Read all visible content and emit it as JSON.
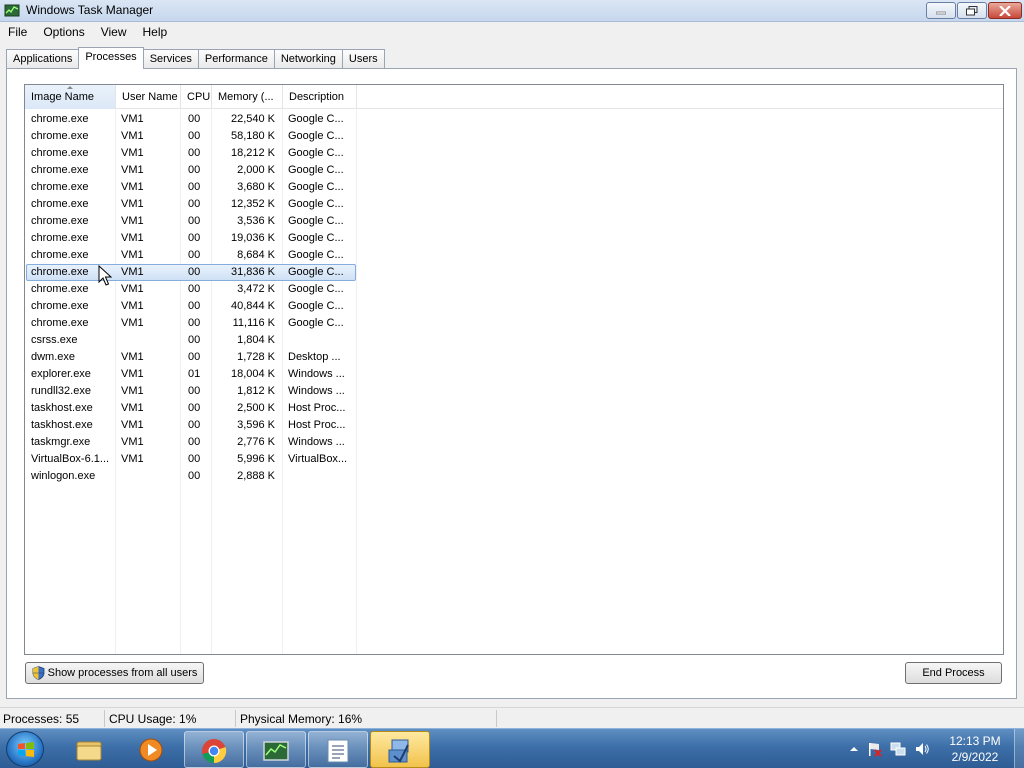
{
  "window": {
    "title": "Windows Task Manager",
    "buttons": [
      "minimize",
      "maximize",
      "close"
    ]
  },
  "menu": [
    "File",
    "Options",
    "View",
    "Help"
  ],
  "tabs": [
    {
      "label": "Applications",
      "active": false
    },
    {
      "label": "Processes",
      "active": true
    },
    {
      "label": "Services",
      "active": false
    },
    {
      "label": "Performance",
      "active": false
    },
    {
      "label": "Networking",
      "active": false
    },
    {
      "label": "Users",
      "active": false
    }
  ],
  "columns": {
    "image_name": "Image Name",
    "user_name": "User Name",
    "cpu": "CPU",
    "memory": "Memory (...",
    "description": "Description"
  },
  "processes": [
    {
      "name": "chrome.exe",
      "user": "VM1",
      "cpu": "00",
      "mem": "22,540 K",
      "desc": "Google C..."
    },
    {
      "name": "chrome.exe",
      "user": "VM1",
      "cpu": "00",
      "mem": "58,180 K",
      "desc": "Google C..."
    },
    {
      "name": "chrome.exe",
      "user": "VM1",
      "cpu": "00",
      "mem": "18,212 K",
      "desc": "Google C..."
    },
    {
      "name": "chrome.exe",
      "user": "VM1",
      "cpu": "00",
      "mem": "2,000 K",
      "desc": "Google C..."
    },
    {
      "name": "chrome.exe",
      "user": "VM1",
      "cpu": "00",
      "mem": "3,680 K",
      "desc": "Google C..."
    },
    {
      "name": "chrome.exe",
      "user": "VM1",
      "cpu": "00",
      "mem": "12,352 K",
      "desc": "Google C..."
    },
    {
      "name": "chrome.exe",
      "user": "VM1",
      "cpu": "00",
      "mem": "3,536 K",
      "desc": "Google C..."
    },
    {
      "name": "chrome.exe",
      "user": "VM1",
      "cpu": "00",
      "mem": "19,036 K",
      "desc": "Google C..."
    },
    {
      "name": "chrome.exe",
      "user": "VM1",
      "cpu": "00",
      "mem": "8,684 K",
      "desc": "Google C..."
    },
    {
      "name": "chrome.exe",
      "user": "VM1",
      "cpu": "00",
      "mem": "31,836 K",
      "desc": "Google C...",
      "selected": true
    },
    {
      "name": "chrome.exe",
      "user": "VM1",
      "cpu": "00",
      "mem": "3,472 K",
      "desc": "Google C..."
    },
    {
      "name": "chrome.exe",
      "user": "VM1",
      "cpu": "00",
      "mem": "40,844 K",
      "desc": "Google C..."
    },
    {
      "name": "chrome.exe",
      "user": "VM1",
      "cpu": "00",
      "mem": "11,116 K",
      "desc": "Google C..."
    },
    {
      "name": "csrss.exe",
      "user": "",
      "cpu": "00",
      "mem": "1,804 K",
      "desc": ""
    },
    {
      "name": "dwm.exe",
      "user": "VM1",
      "cpu": "00",
      "mem": "1,728 K",
      "desc": "Desktop ..."
    },
    {
      "name": "explorer.exe",
      "user": "VM1",
      "cpu": "01",
      "mem": "18,004 K",
      "desc": "Windows ..."
    },
    {
      "name": "rundll32.exe",
      "user": "VM1",
      "cpu": "00",
      "mem": "1,812 K",
      "desc": "Windows ..."
    },
    {
      "name": "taskhost.exe",
      "user": "VM1",
      "cpu": "00",
      "mem": "2,500 K",
      "desc": "Host Proc..."
    },
    {
      "name": "taskhost.exe",
      "user": "VM1",
      "cpu": "00",
      "mem": "3,596 K",
      "desc": "Host Proc..."
    },
    {
      "name": "taskmgr.exe",
      "user": "VM1",
      "cpu": "00",
      "mem": "2,776 K",
      "desc": "Windows ..."
    },
    {
      "name": "VirtualBox-6.1...",
      "user": "VM1",
      "cpu": "00",
      "mem": "5,996 K",
      "desc": "VirtualBox..."
    },
    {
      "name": "winlogon.exe",
      "user": "",
      "cpu": "00",
      "mem": "2,888 K",
      "desc": ""
    }
  ],
  "buttons": {
    "show_all": "Show processes from all users",
    "end_process": "End Process"
  },
  "status": {
    "processes": "Processes: 55",
    "cpu": "CPU Usage: 1%",
    "memory": "Physical Memory: 16%"
  },
  "taskbar": {
    "items": [
      "explorer-folder-icon",
      "media-player-icon",
      "chrome-icon",
      "task-manager-icon",
      "notepad-icon",
      "virtualbox-icon"
    ],
    "time": "12:13 PM",
    "date": "2/9/2022"
  },
  "colors": {
    "selection_bg": "#cfe1f6",
    "selection_border": "#84acdd",
    "taskbar": "#3d6fa8"
  }
}
